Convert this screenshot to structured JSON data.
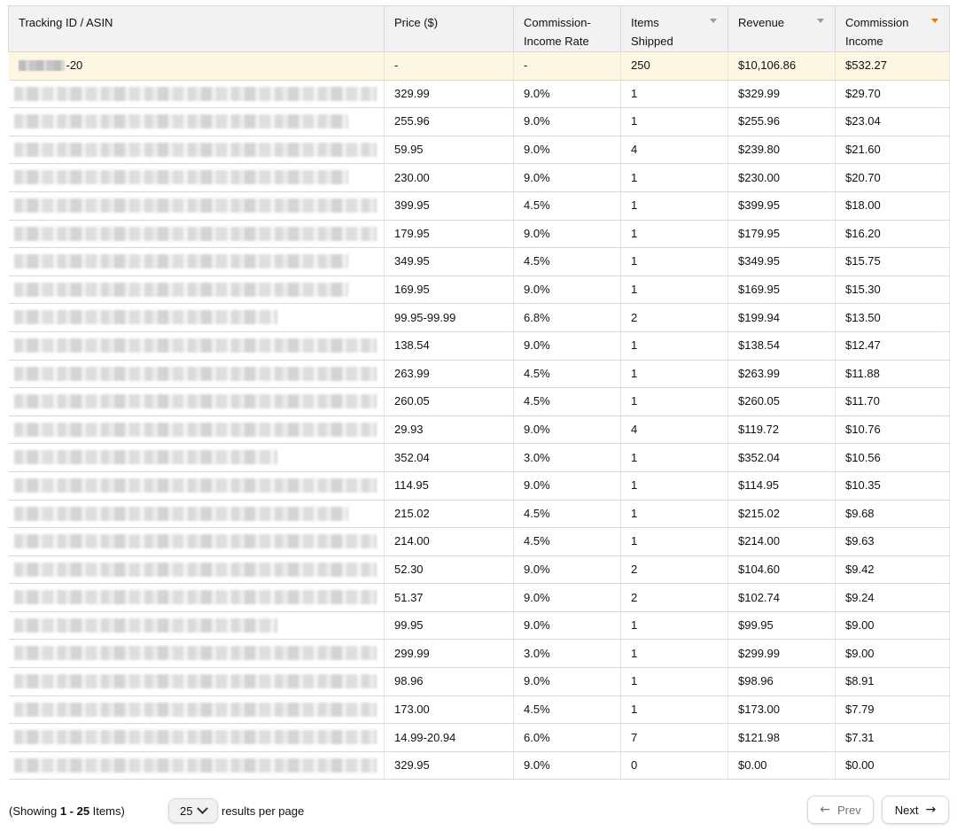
{
  "table": {
    "headers": [
      {
        "key": "tracking",
        "label": "Tracking ID / ASIN",
        "sortable": false
      },
      {
        "key": "price",
        "label": "Price ($)",
        "sortable": false
      },
      {
        "key": "rate",
        "label": "Commission-\nIncome Rate",
        "sortable": false
      },
      {
        "key": "items",
        "label": "Items\nShipped",
        "sortable": true,
        "active": false
      },
      {
        "key": "revenue",
        "label": "Revenue",
        "sortable": true,
        "active": false
      },
      {
        "key": "commission",
        "label": "Commission\nIncome",
        "sortable": true,
        "active": true
      }
    ],
    "summary": {
      "tracking_suffix": "-20",
      "price": "-",
      "rate": "-",
      "items": "250",
      "revenue": "$10,106.86",
      "commission": "$532.27"
    },
    "rows": [
      {
        "price": "329.99",
        "rate": "9.0%",
        "items": "1",
        "revenue": "$329.99",
        "commission": "$29.70"
      },
      {
        "price": "255.96",
        "rate": "9.0%",
        "items": "1",
        "revenue": "$255.96",
        "commission": "$23.04"
      },
      {
        "price": "59.95",
        "rate": "9.0%",
        "items": "4",
        "revenue": "$239.80",
        "commission": "$21.60"
      },
      {
        "price": "230.00",
        "rate": "9.0%",
        "items": "1",
        "revenue": "$230.00",
        "commission": "$20.70"
      },
      {
        "price": "399.95",
        "rate": "4.5%",
        "items": "1",
        "revenue": "$399.95",
        "commission": "$18.00"
      },
      {
        "price": "179.95",
        "rate": "9.0%",
        "items": "1",
        "revenue": "$179.95",
        "commission": "$16.20"
      },
      {
        "price": "349.95",
        "rate": "4.5%",
        "items": "1",
        "revenue": "$349.95",
        "commission": "$15.75"
      },
      {
        "price": "169.95",
        "rate": "9.0%",
        "items": "1",
        "revenue": "$169.95",
        "commission": "$15.30"
      },
      {
        "price": "99.95-99.99",
        "rate": "6.8%",
        "items": "2",
        "revenue": "$199.94",
        "commission": "$13.50"
      },
      {
        "price": "138.54",
        "rate": "9.0%",
        "items": "1",
        "revenue": "$138.54",
        "commission": "$12.47"
      },
      {
        "price": "263.99",
        "rate": "4.5%",
        "items": "1",
        "revenue": "$263.99",
        "commission": "$11.88"
      },
      {
        "price": "260.05",
        "rate": "4.5%",
        "items": "1",
        "revenue": "$260.05",
        "commission": "$11.70"
      },
      {
        "price": "29.93",
        "rate": "9.0%",
        "items": "4",
        "revenue": "$119.72",
        "commission": "$10.76"
      },
      {
        "price": "352.04",
        "rate": "3.0%",
        "items": "1",
        "revenue": "$352.04",
        "commission": "$10.56"
      },
      {
        "price": "114.95",
        "rate": "9.0%",
        "items": "1",
        "revenue": "$114.95",
        "commission": "$10.35"
      },
      {
        "price": "215.02",
        "rate": "4.5%",
        "items": "1",
        "revenue": "$215.02",
        "commission": "$9.68"
      },
      {
        "price": "214.00",
        "rate": "4.5%",
        "items": "1",
        "revenue": "$214.00",
        "commission": "$9.63"
      },
      {
        "price": "52.30",
        "rate": "9.0%",
        "items": "2",
        "revenue": "$104.60",
        "commission": "$9.42"
      },
      {
        "price": "51.37",
        "rate": "9.0%",
        "items": "2",
        "revenue": "$102.74",
        "commission": "$9.24"
      },
      {
        "price": "99.95",
        "rate": "9.0%",
        "items": "1",
        "revenue": "$99.95",
        "commission": "$9.00"
      },
      {
        "price": "299.99",
        "rate": "3.0%",
        "items": "1",
        "revenue": "$299.99",
        "commission": "$9.00"
      },
      {
        "price": "98.96",
        "rate": "9.0%",
        "items": "1",
        "revenue": "$98.96",
        "commission": "$8.91"
      },
      {
        "price": "173.00",
        "rate": "4.5%",
        "items": "1",
        "revenue": "$173.00",
        "commission": "$7.79"
      },
      {
        "price": "14.99-20.94",
        "rate": "6.0%",
        "items": "7",
        "revenue": "$121.98",
        "commission": "$7.31"
      },
      {
        "price": "329.95",
        "rate": "9.0%",
        "items": "0",
        "revenue": "$0.00",
        "commission": "$0.00"
      }
    ]
  },
  "footer": {
    "showing_prefix": "(Showing ",
    "showing_range": "1 - 25",
    "showing_suffix": " Items)",
    "per_page_value": "25",
    "per_page_label": "results per page",
    "prev_label": "Prev",
    "next_label": "Next",
    "prev_arrow": "←",
    "next_arrow": "→"
  },
  "colors": {
    "header_bg": "#f2f2f2",
    "summary_bg": "#fdf6e3",
    "sort_active": "#e77600",
    "border": "#d5d9d9"
  }
}
